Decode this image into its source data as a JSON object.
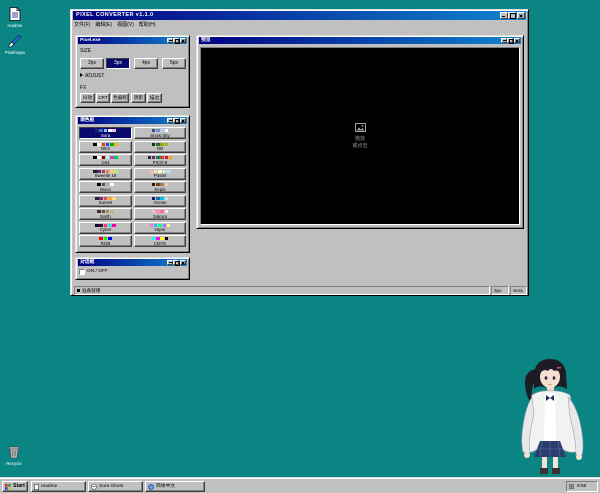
{
  "desktop": {
    "background_color": "#0a8584",
    "icons": [
      {
        "label": "readme",
        "icon": "text-file-icon"
      },
      {
        "label": "Pixelmaps",
        "icon": "brush-icon"
      },
      {
        "label": "Recycle",
        "icon": "recycle-bin-icon"
      }
    ]
  },
  "main_window": {
    "title": "PIXEL CONVERTER v1.1.0",
    "menu": [
      "文件(F)",
      "编辑(E)",
      "视图(V)",
      "帮助(H)"
    ],
    "status": {
      "message": "准备就绪",
      "size": "3px",
      "palette": "Sora"
    }
  },
  "pixel_panel": {
    "title": "Pixel.exe",
    "size_label": "SIZE",
    "sizes": [
      "2px",
      "3px",
      "4px",
      "5px"
    ],
    "selected_size": "3px",
    "adjust_label": "ADJUST",
    "adjust_expanded": false,
    "fx_label": "FX",
    "fx": [
      "抖动",
      "CRT",
      "色偏移",
      "阴影",
      "描边"
    ]
  },
  "palette_panel": {
    "title": "调色板",
    "selected": "Sora",
    "items": [
      {
        "name": "Sora",
        "colors": [
          "#1b2a6b",
          "#3b6fd6",
          "#8fc1ff",
          "#ffffff",
          "#f4c2d8"
        ]
      },
      {
        "name": "Snow Sky",
        "colors": [
          "#3b4a7a",
          "#6c8cc8",
          "#b6cff0",
          "#ffffff"
        ]
      },
      {
        "name": "NES",
        "colors": [
          "#000000",
          "#fcfcfc",
          "#f83800",
          "#0058f8",
          "#00a800",
          "#f8b800"
        ]
      },
      {
        "name": "GB",
        "colors": [
          "#0f380f",
          "#306230",
          "#8bac0f",
          "#9bbc0f"
        ]
      },
      {
        "name": "C64",
        "colors": [
          "#000000",
          "#ffffff",
          "#880000",
          "#aaffee",
          "#cc44cc",
          "#00cc55"
        ]
      },
      {
        "name": "PICO-8",
        "colors": [
          "#1d2b53",
          "#7e2553",
          "#008751",
          "#ab5236",
          "#ff004d",
          "#ffa300"
        ]
      },
      {
        "name": "Sweetie 16",
        "colors": [
          "#1a1c2c",
          "#5d275d",
          "#b13e53",
          "#ef7d57",
          "#ffcd75",
          "#a7f070"
        ]
      },
      {
        "name": "Pastel",
        "colors": [
          "#ffb3ba",
          "#ffdfba",
          "#ffffba",
          "#baffc9",
          "#bae1ff"
        ]
      },
      {
        "name": "Mono",
        "colors": [
          "#000000",
          "#555555",
          "#aaaaaa",
          "#ffffff"
        ]
      },
      {
        "name": "Sepia",
        "colors": [
          "#2b1d0e",
          "#704214",
          "#a67b5b",
          "#e8d3b0"
        ]
      },
      {
        "name": "Sunset",
        "colors": [
          "#2d1b4e",
          "#7b2d5e",
          "#d94f3d",
          "#f7a440",
          "#ffd97a"
        ]
      },
      {
        "name": "Ocean",
        "colors": [
          "#03256c",
          "#1768ac",
          "#06bee1",
          "#b5e8f7"
        ]
      },
      {
        "name": "Earth",
        "colors": [
          "#3b2f2f",
          "#6b4f3a",
          "#8a9a5b",
          "#c2b280"
        ]
      },
      {
        "name": "Sakura",
        "colors": [
          "#ffb7c5",
          "#ff8fab",
          "#fb6f92",
          "#ffe5ec"
        ]
      },
      {
        "name": "Cyber",
        "colors": [
          "#0d0221",
          "#261447",
          "#ff3864",
          "#2de2e6",
          "#f6019d"
        ]
      },
      {
        "name": "Vapor",
        "colors": [
          "#ff71ce",
          "#01cdfe",
          "#05ffa1",
          "#b967ff",
          "#fffb96"
        ]
      },
      {
        "name": "RGB",
        "colors": [
          "#ff0000",
          "#00ff00",
          "#0000ff"
        ]
      },
      {
        "name": "CMYK",
        "colors": [
          "#00ffff",
          "#ff00ff",
          "#ffff00",
          "#000000"
        ]
      }
    ]
  },
  "dialog_panel": {
    "title": "对话框",
    "toggle_label": "ON / OFF",
    "checked": false
  },
  "preview_panel": {
    "title": "预览",
    "placeholder_icon": "image-icon",
    "placeholder": [
      "拖放",
      "或点击"
    ]
  },
  "taskbar": {
    "start_label": "Start",
    "tasks": [
      {
        "label": "readme",
        "icon": "text-file-icon"
      },
      {
        "label": "Sora Ghost",
        "icon": "ghost-icon"
      },
      {
        "label": "简体中文",
        "icon": "globe-icon"
      }
    ],
    "clock": "9:58"
  },
  "colors": {
    "title_bar_start": "#000080",
    "title_bar_end": "#1084d0",
    "window_face": "#c0c0c0",
    "selected": "#0a0a6e",
    "preview_bg": "#000000"
  }
}
